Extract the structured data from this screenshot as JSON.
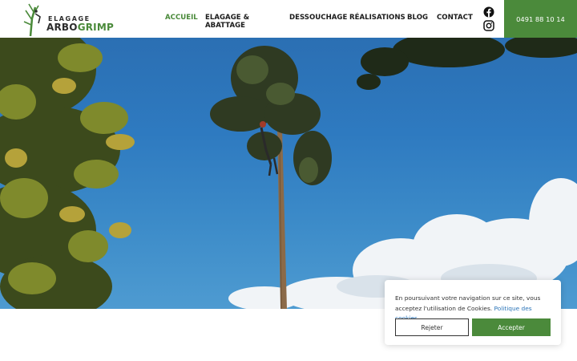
{
  "header": {
    "logo": {
      "small_text": "ELAGAGE",
      "brand_part1": "ARBO",
      "brand_part2": "GRIMP"
    },
    "nav": [
      {
        "label": "ACCUEIL",
        "active": true
      },
      {
        "label": "ELAGAGE & ABATTAGE",
        "active": false
      },
      {
        "label": "DESSOUCHAGE",
        "active": false
      },
      {
        "label": "RÉALISATIONS",
        "active": false
      },
      {
        "label": "BLOG",
        "active": false
      },
      {
        "label": "CONTACT",
        "active": false
      }
    ],
    "social": [
      {
        "icon": "facebook-icon"
      },
      {
        "icon": "instagram-icon"
      }
    ],
    "phone": "0491 88 10 14"
  },
  "hero": {
    "image": "tree-climber-against-blue-sky"
  },
  "cookie_banner": {
    "text": "En poursuivant votre navigation sur ce site, vous acceptez l'utilisation de Cookies.",
    "policy_link": "Politique des cookies",
    "reject_label": "Rejeter",
    "accept_label": "Accepter"
  },
  "colors": {
    "brand_green": "#4b8a3b",
    "link_blue": "#2b74b8",
    "sky_blue": "#2e7ac0"
  }
}
